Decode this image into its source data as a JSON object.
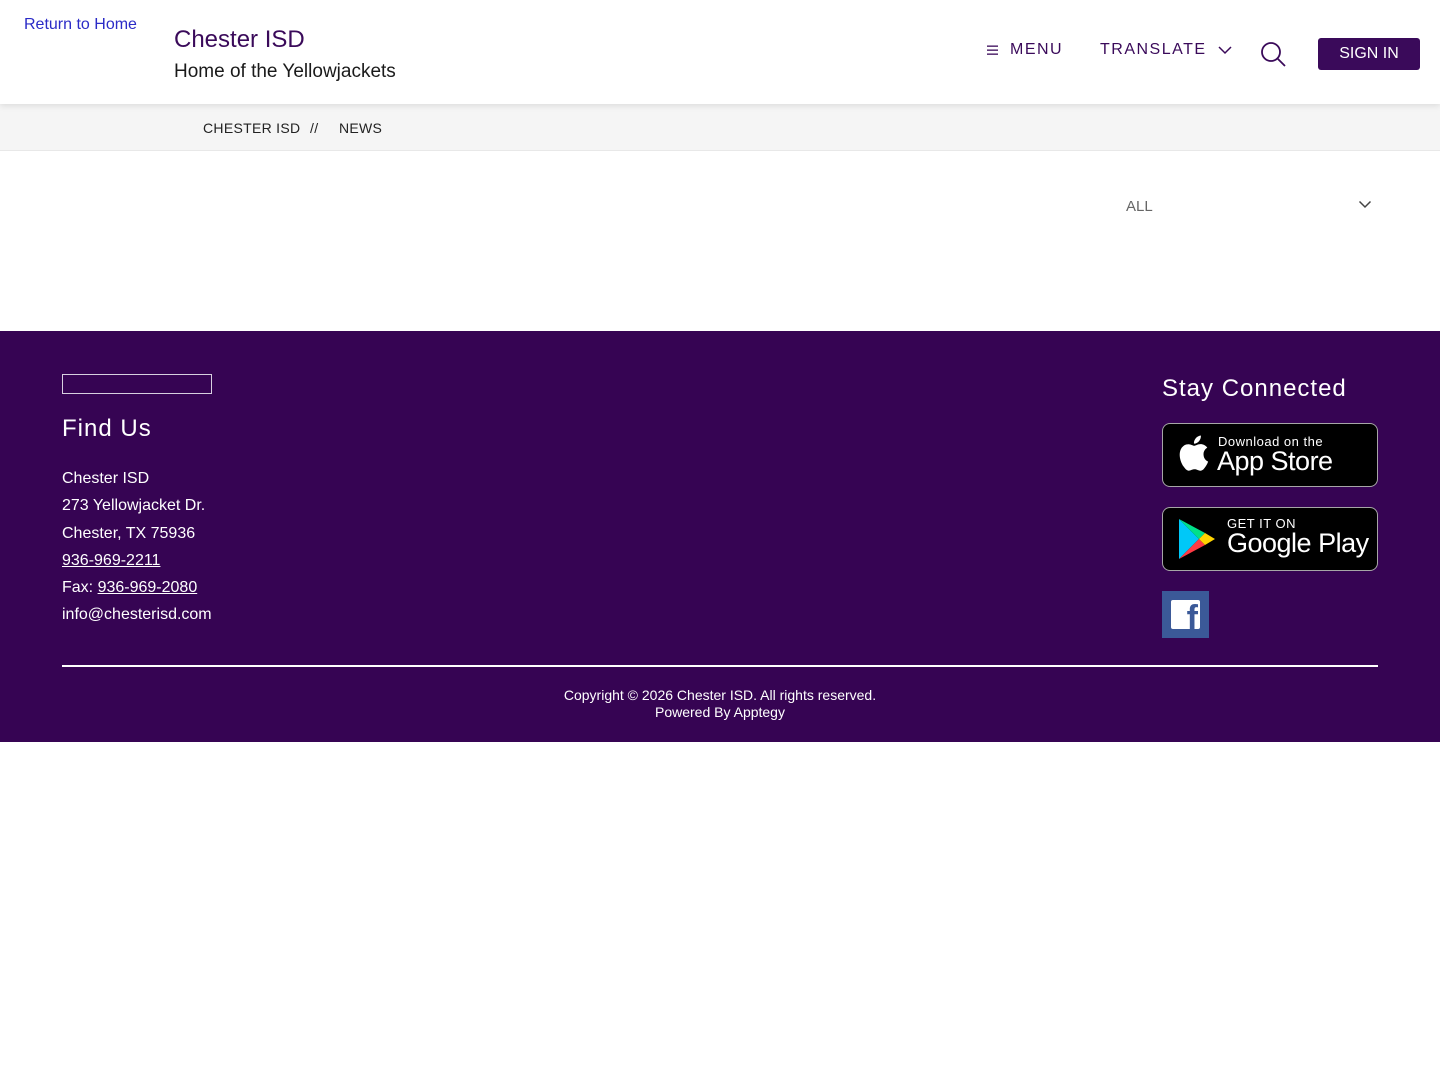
{
  "header": {
    "home_link_alt": "Return to Home",
    "site_title": "Chester ISD",
    "site_subtitle": "Home of the Yellowjackets",
    "menu_label": "MENU",
    "translate_label": "TRANSLATE",
    "sign_in_label": "SIGN IN"
  },
  "breadcrumb": {
    "home": "CHESTER ISD",
    "separator": "//",
    "current": "NEWS"
  },
  "filter": {
    "selected": "ALL"
  },
  "footer": {
    "find_us_heading": "Find Us",
    "address": {
      "name": "Chester ISD",
      "street": "273 Yellowjacket Dr.",
      "city": "Chester, TX 75936",
      "phone": "936-969-2211",
      "fax_label": "Fax:",
      "fax": "936-969-2080",
      "email": "info@chesterisd.com"
    },
    "stay_connected_heading": "Stay Connected",
    "app_store": {
      "small": "Download on the",
      "big": "App Store"
    },
    "google_play": {
      "small": "GET IT ON",
      "big": "Google Play"
    },
    "copyright": "Copyright © 2026 Chester ISD. All rights reserved.",
    "powered_by": "Powered By Apptegy"
  },
  "colors": {
    "brand_purple": "#360453",
    "header_purple": "#3a0a5a",
    "facebook_blue": "#3b5998"
  },
  "icons": {
    "menu": "hamburger-icon",
    "translate": "chevron-down-icon",
    "search": "search-icon",
    "filter": "chevron-down-icon",
    "apple": "apple-icon",
    "google_play": "google-play-icon",
    "facebook": "facebook-icon"
  }
}
